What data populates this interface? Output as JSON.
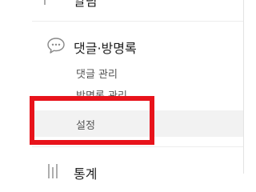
{
  "sidebar": {
    "prev_menu_label": "알림",
    "comments_menu": {
      "label": "댓글·방명록",
      "icon": "speech-bubble-icon",
      "items": [
        {
          "label": "댓글 관리"
        },
        {
          "label": "방명록 관리"
        },
        {
          "label": "설정",
          "selected": true
        }
      ]
    },
    "stats_menu_label": "통계"
  },
  "colors": {
    "highlight": "#e8131b",
    "selected_bg": "#f2f2f2",
    "divider": "#ececec"
  }
}
